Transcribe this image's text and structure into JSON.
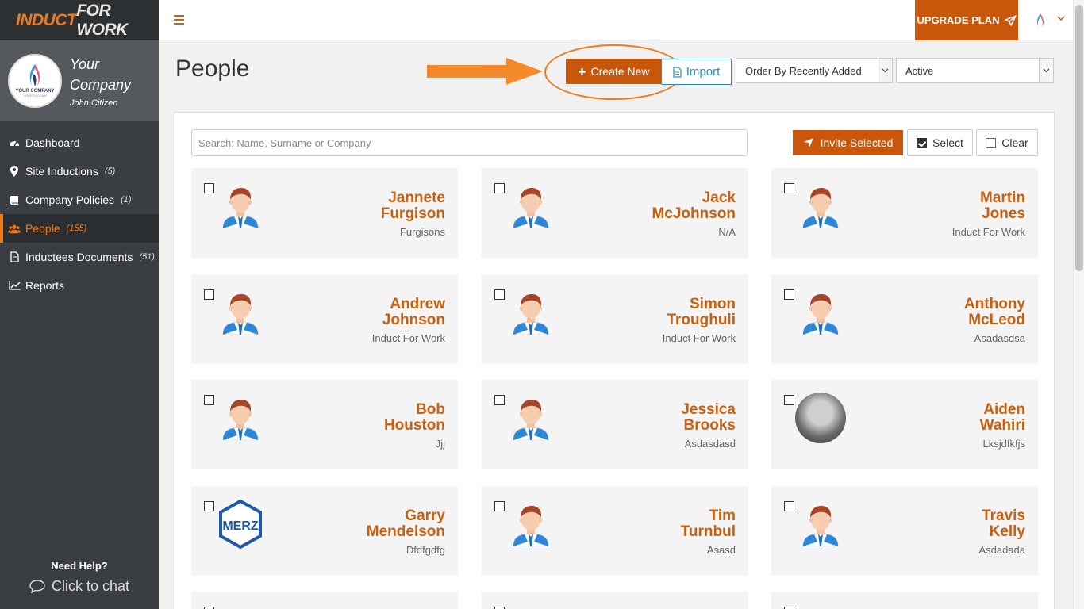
{
  "brand": {
    "part1": "INDUCT",
    "part2": "FOR WORK"
  },
  "company": {
    "name": "Your Company",
    "user": "John Citizen",
    "logo_text": "YOUR COMPANY",
    "logo_sub": "YOUR SLOGAN"
  },
  "nav": [
    {
      "label": "Dashboard",
      "count": "",
      "icon": "dashboard-icon"
    },
    {
      "label": "Site Inductions",
      "count": "(5)",
      "icon": "map-pin-icon"
    },
    {
      "label": "Company Policies",
      "count": "(1)",
      "icon": "book-icon"
    },
    {
      "label": "People",
      "count": "(155)",
      "icon": "users-icon",
      "active": true
    },
    {
      "label": "Inductees Documents",
      "count": "(51)",
      "icon": "document-icon"
    },
    {
      "label": "Reports",
      "count": "",
      "icon": "chart-line-icon"
    }
  ],
  "help": {
    "title": "Need Help?",
    "chat": "Click to chat"
  },
  "topbar": {
    "upgrade": "UPGRADE PLAN"
  },
  "page": {
    "title": "People",
    "create_new": "Create New",
    "import": "Import",
    "order_select": "Order By Recently Added",
    "status_select": "Active"
  },
  "toolbar": {
    "search_placeholder": "Search: Name, Surname or Company",
    "invite": "Invite Selected",
    "select": "Select",
    "clear": "Clear"
  },
  "people": [
    {
      "first": "Jannete",
      "last": "Furgison",
      "company": "Furgisons",
      "avatar": "default"
    },
    {
      "first": "Jack",
      "last": "McJohnson",
      "company": "N/A",
      "avatar": "default"
    },
    {
      "first": "Martin",
      "last": "Jones",
      "company": "Induct For Work",
      "avatar": "default"
    },
    {
      "first": "Andrew",
      "last": "Johnson",
      "company": "Induct For Work",
      "avatar": "default"
    },
    {
      "first": "Simon",
      "last": "Troughuli",
      "company": "Induct For Work",
      "avatar": "default"
    },
    {
      "first": "Anthony",
      "last": "McLeod",
      "company": "Asadasdsa",
      "avatar": "default"
    },
    {
      "first": "Bob",
      "last": "Houston",
      "company": "Jjj",
      "avatar": "default"
    },
    {
      "first": "Jessica",
      "last": "Brooks",
      "company": "Asdasdasd",
      "avatar": "default"
    },
    {
      "first": "Aiden",
      "last": "Wahiri",
      "company": "Lksjdfkfjs",
      "avatar": "photo"
    },
    {
      "first": "Garry",
      "last": "Mendelson",
      "company": "Dfdfgdfg",
      "avatar": "merz"
    },
    {
      "first": "Tim",
      "last": "Turnbul",
      "company": "Asasd",
      "avatar": "default"
    },
    {
      "first": "Travis",
      "last": "Kelly",
      "company": "Asdadada",
      "avatar": "default"
    }
  ],
  "merz_text": "MERZ"
}
